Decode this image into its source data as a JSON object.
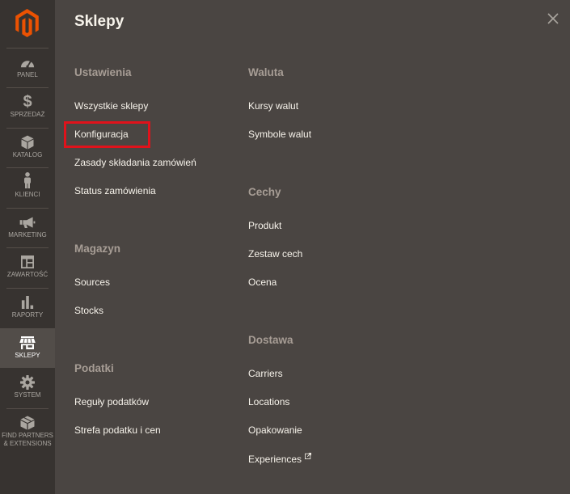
{
  "sidebar": {
    "logo_icon": "magento-logo-icon",
    "items": [
      {
        "label": "PANEL",
        "icon": "dashboard-icon"
      },
      {
        "label": "SPRZEDAŻ",
        "icon": "dollar-icon",
        "icon_glyph": "$"
      },
      {
        "label": "KATALOG",
        "icon": "box-icon"
      },
      {
        "label": "KLIENCI",
        "icon": "person-icon"
      },
      {
        "label": "MARKETING",
        "icon": "megaphone-icon"
      },
      {
        "label": "ZAWARTOŚĆ",
        "icon": "layout-icon"
      },
      {
        "label": "RAPORTY",
        "icon": "bar-chart-icon"
      },
      {
        "label": "SKLEPY",
        "icon": "store-icon",
        "active": true
      },
      {
        "label": "SYSTEM",
        "icon": "gear-icon"
      },
      {
        "label_lines": [
          "FIND PARTNERS",
          "& EXTENSIONS"
        ],
        "icon": "partners-box-icon"
      }
    ]
  },
  "panel": {
    "title": "Sklepy",
    "close_icon": "close-icon",
    "columns": [
      {
        "groups": [
          {
            "heading": "Ustawienia",
            "links": [
              {
                "label": "Wszystkie sklepy"
              },
              {
                "label": "Konfiguracja",
                "highlighted": true
              },
              {
                "label": "Zasady składania zamówień"
              },
              {
                "label": "Status zamówienia"
              }
            ]
          },
          {
            "heading": "Magazyn",
            "links": [
              {
                "label": "Sources"
              },
              {
                "label": "Stocks"
              }
            ]
          },
          {
            "heading": "Podatki",
            "links": [
              {
                "label": "Reguły podatków"
              },
              {
                "label": "Strefa podatku i cen"
              }
            ]
          }
        ]
      },
      {
        "groups": [
          {
            "heading": "Waluta",
            "links": [
              {
                "label": "Kursy walut"
              },
              {
                "label": "Symbole walut"
              }
            ]
          },
          {
            "heading": "Cechy",
            "links": [
              {
                "label": "Produkt"
              },
              {
                "label": "Zestaw cech"
              },
              {
                "label": "Ocena"
              }
            ]
          },
          {
            "heading": "Dostawa",
            "links": [
              {
                "label": "Carriers"
              },
              {
                "label": "Locations"
              },
              {
                "label": "Opakowanie"
              },
              {
                "label": "Experiences",
                "external": true,
                "icon": "external-link-icon"
              }
            ]
          }
        ]
      }
    ]
  },
  "colors": {
    "brand_orange": "#eb5202",
    "sidebar_bg": "#373330",
    "panel_bg": "#4a4542",
    "active_item_bg": "#524d49",
    "sidebar_text": "#aaa6a0",
    "heading_text": "#a79d95",
    "link_text": "#f7f3eb",
    "highlight_border": "#e0121b"
  }
}
